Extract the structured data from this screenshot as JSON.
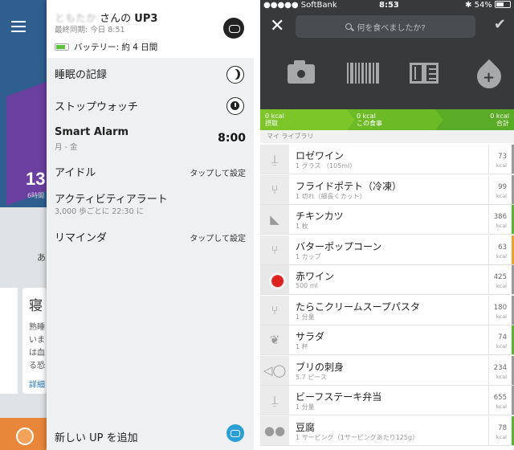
{
  "left_panel": {
    "menu": {
      "header": {
        "user_name": "ともたか",
        "name_suffix": " さんの ",
        "device": "UP3",
        "last_sync": "最終同期: 今日 8:51",
        "battery": "バッテリー: 約 4 日間"
      },
      "items": [
        {
          "label": "睡眠の記録",
          "icon": "moon-icon"
        },
        {
          "label": "ストップウォッチ",
          "icon": "stopwatch-icon"
        },
        {
          "label": "Smart Alarm",
          "sub": "月 - 金",
          "value": "8:00"
        },
        {
          "label": "アイドル",
          "value": "タップして設定"
        },
        {
          "label": "アクティビティアラート",
          "sub": "3,000 歩ごとに 22:30 に"
        },
        {
          "label": "リマインダ",
          "value": "タップして設定"
        }
      ],
      "add_up": "新しい UP を追加"
    },
    "background": {
      "big_number": "13",
      "small_text": "6時間",
      "char_a": "あ",
      "card_title": "寝",
      "card_lines": [
        "熟睡",
        "いま",
        "は血",
        "る恐"
      ],
      "card_link": "詳細"
    }
  },
  "right_panel": {
    "status_bar": {
      "carrier": "●●●●● SoftBank",
      "time": "8:53",
      "battery": "54%",
      "signal_icons": [
        "wifi-icon",
        "location-icon",
        "bluetooth-icon"
      ]
    },
    "search": {
      "placeholder": "何を食べましたか?"
    },
    "toolbar_icons": [
      "camera-icon",
      "barcode-icon",
      "menu-book-icon",
      "water-drop-icon"
    ],
    "kcal_bar": [
      {
        "value": "0 kcal",
        "label": "摂取"
      },
      {
        "value": "0 kcal",
        "label": "この食事"
      },
      {
        "value": "0 kcal",
        "label": "合計"
      }
    ],
    "library_header": "マイ ライブラリ",
    "foods": [
      {
        "name": "ロゼワイン",
        "serving": "1 グラス （105ml）",
        "kcal": "73",
        "icon": "drink-icon",
        "color": "#9a9a9a"
      },
      {
        "name": "フライドポテト（冷凍）",
        "serving": "1 切れ（細長くカット）",
        "kcal": "99",
        "icon": "fork-knife-icon",
        "color": "#9a9a9a"
      },
      {
        "name": "チキンカツ",
        "serving": "1 枚",
        "kcal": "386",
        "icon": "sandwich-icon",
        "color": "#5ab331"
      },
      {
        "name": "バターポップコーン",
        "serving": "1 カップ",
        "kcal": "63",
        "icon": "fork-knife-icon",
        "color": "#f0a030"
      },
      {
        "name": "赤ワイン",
        "serving": "500 ml",
        "kcal": "425",
        "icon": "wine-photo",
        "color": "#9a9a9a"
      },
      {
        "name": "たらこクリームスープパスタ",
        "serving": "1 分量",
        "kcal": "180",
        "icon": "fork-knife-icon",
        "color": "#9a9a9a"
      },
      {
        "name": "サラダ",
        "serving": "1 杯",
        "kcal": "74",
        "icon": "salad-icon",
        "color": "#5ab331"
      },
      {
        "name": "ブリの刺身",
        "serving": "5.7 ピース",
        "kcal": "234",
        "icon": "fish-icon",
        "color": "#9a9a9a"
      },
      {
        "name": "ビーフステーキ弁当",
        "serving": "1 分量",
        "kcal": "655",
        "icon": "drink-icon",
        "color": "#9a9a9a"
      },
      {
        "name": "豆腐",
        "serving": "1 サービング（1サービングあたり125g）",
        "kcal": "78",
        "icon": "beans-icon",
        "color": "#5ab331"
      }
    ],
    "kcal_unit": "kcal"
  }
}
